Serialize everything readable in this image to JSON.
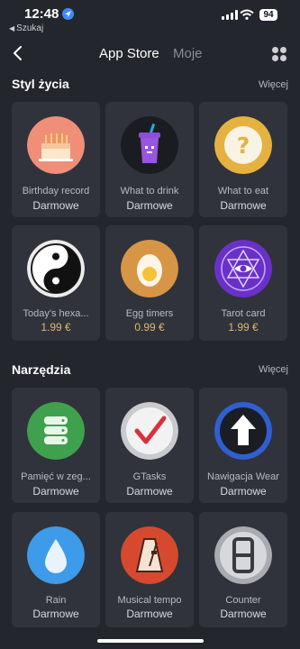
{
  "status_bar": {
    "time": "12:48",
    "back_app": "Szukaj",
    "battery": "94"
  },
  "nav": {
    "tabs": [
      "App Store",
      "Moje"
    ]
  },
  "sections": [
    {
      "title": "Styl życia",
      "more": "Więcej",
      "apps": [
        {
          "name": "Birthday record",
          "price": "Darmowe",
          "icon": "birthday-cake-icon"
        },
        {
          "name": "What to drink",
          "price": "Darmowe",
          "icon": "drink-cup-icon"
        },
        {
          "name": "What to eat",
          "price": "Darmowe",
          "icon": "question-mark-icon"
        },
        {
          "name": "Today's hexa...",
          "price": "1.99 €",
          "icon": "yin-yang-icon"
        },
        {
          "name": "Egg timers",
          "price": "0.99 €",
          "icon": "egg-icon"
        },
        {
          "name": "Tarot card",
          "price": "1.99 €",
          "icon": "tarot-eye-icon"
        }
      ]
    },
    {
      "title": "Narzędzia",
      "more": "Więcej",
      "apps": [
        {
          "name": "Pamięć w zeg...",
          "price": "Darmowe",
          "icon": "database-icon"
        },
        {
          "name": "GTasks",
          "price": "Darmowe",
          "icon": "checkmark-icon"
        },
        {
          "name": "Nawigacja Wear",
          "price": "Darmowe",
          "icon": "navigation-arrow-icon"
        },
        {
          "name": "Rain",
          "price": "Darmowe",
          "icon": "water-drop-icon"
        },
        {
          "name": "Musical tempo",
          "price": "Darmowe",
          "icon": "metronome-icon"
        },
        {
          "name": "Counter",
          "price": "Darmowe",
          "icon": "digit-eight-icon"
        }
      ]
    }
  ]
}
